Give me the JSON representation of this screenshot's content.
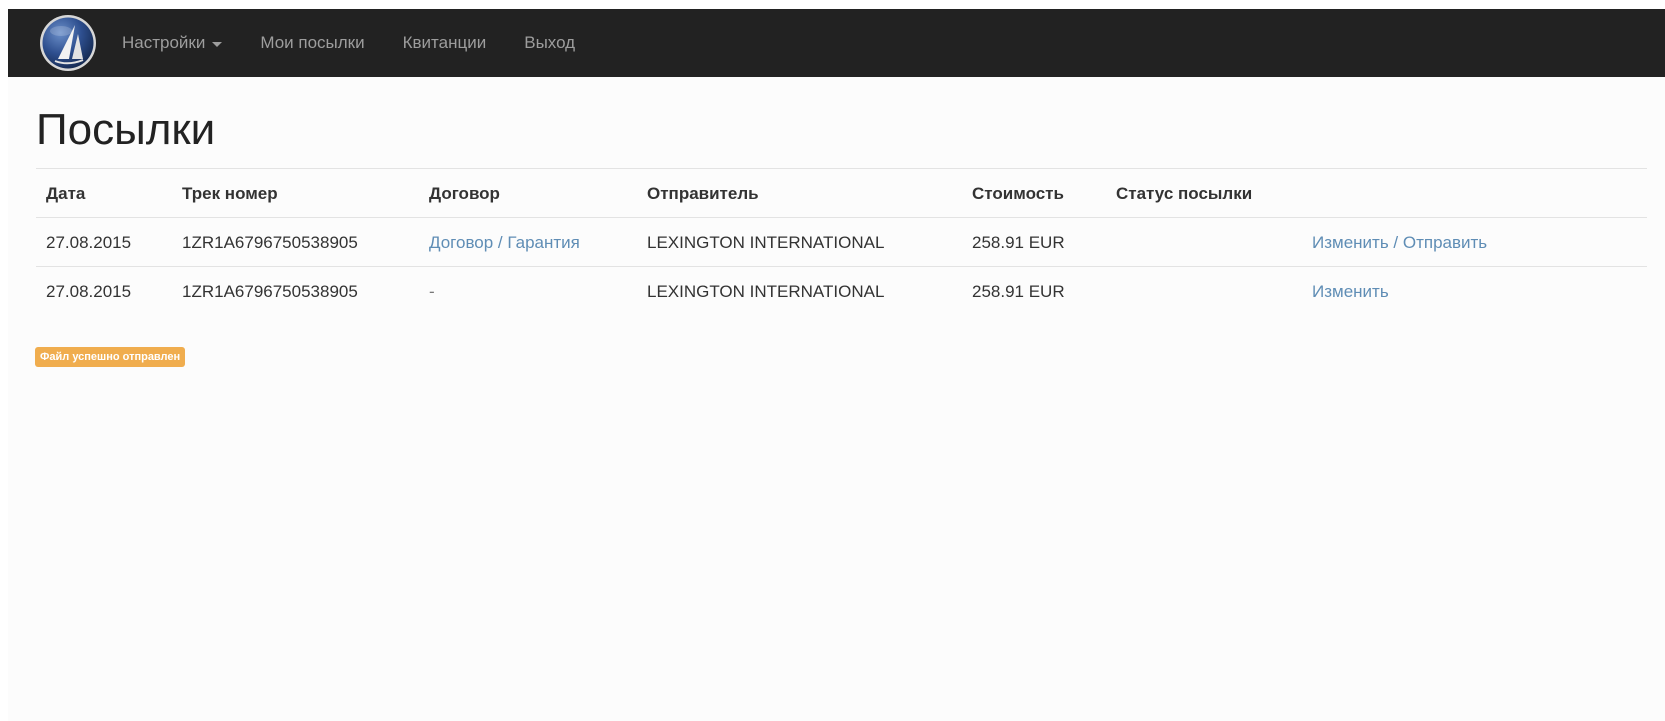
{
  "navbar": {
    "logo_icon": "sailboat-logo-icon",
    "items": [
      {
        "label": "Настройки",
        "has_dropdown": true
      },
      {
        "label": "Мои посылки"
      },
      {
        "label": "Квитанции"
      },
      {
        "label": "Выход"
      }
    ]
  },
  "page": {
    "title": "Посылки"
  },
  "table": {
    "headers": [
      "Дата",
      "Трек номер",
      "Договор",
      "Отправитель",
      "Стоимость",
      "Статус посылки",
      ""
    ],
    "rows": [
      {
        "date": "27.08.2015",
        "track": "1ZR1A6796750538905",
        "contract": {
          "link1": "Договор",
          "separator": " / ",
          "link2": "Гарантия"
        },
        "sender": "LEXINGTON INTERNATIONAL",
        "cost": "258.91 EUR",
        "status": "",
        "actions": {
          "edit": "Изменить",
          "separator": " / ",
          "send": "Отправить"
        }
      },
      {
        "date": "27.08.2015",
        "track": "1ZR1A6796750538905",
        "contract": {
          "text": "-"
        },
        "sender": "LEXINGTON INTERNATIONAL",
        "cost": "258.91 EUR",
        "status": "",
        "actions": {
          "edit": "Изменить"
        }
      }
    ]
  },
  "notice": {
    "text": "Файл успешно отправлен"
  },
  "colors": {
    "navbar_bg": "#222222",
    "nav_text": "#9d9d9d",
    "link": "#5f8db5",
    "badge_bg": "#f0ad4e",
    "page_bg": "#fcfcfc"
  }
}
